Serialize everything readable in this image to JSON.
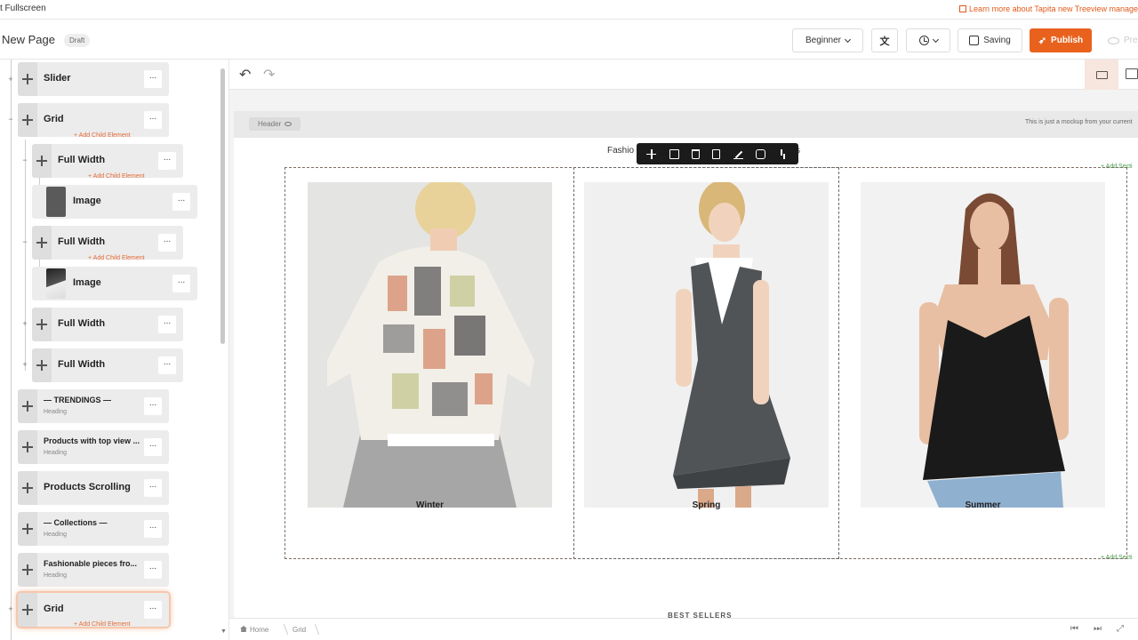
{
  "top_strip": {
    "exit_label": "t Fullscreen",
    "learn_more": "Learn more about Tapita new Treeview manage"
  },
  "header": {
    "page_title": "New Page",
    "status_badge": "Draft",
    "level_select": "Beginner",
    "saving_label": "Saving",
    "publish_label": "Publish",
    "preview_label": "Pre"
  },
  "sidebar": {
    "nodes": [
      {
        "label": "Slider"
      },
      {
        "label": "Grid",
        "add_child": "+ Add Child Element"
      },
      {
        "label": "Full Width",
        "add_child": "+ Add Child Element"
      },
      {
        "label": "Image"
      },
      {
        "label": "Full Width",
        "add_child": "+ Add Child Element"
      },
      {
        "label": "Image"
      },
      {
        "label": "Full Width"
      },
      {
        "label": "Full Width"
      },
      {
        "label": "— TRENDINGS —",
        "sub": "Heading"
      },
      {
        "label": "Products with top view ...",
        "sub": "Heading"
      },
      {
        "label": "Products Scrolling"
      },
      {
        "label": "— Collections —",
        "sub": "Heading"
      },
      {
        "label": "Fashionable pieces fro...",
        "sub": "Heading"
      },
      {
        "label": "Grid",
        "add_child": "+ Add Child Element"
      }
    ],
    "more_glyph": "..."
  },
  "canvas": {
    "header_chip": "Header",
    "mockup_note": "This is just a mockup from your current",
    "fashion_title_start": "Fashio",
    "fashion_title_end": "s",
    "add_section": "+ Add Secti",
    "best_sellers": "BEST SELLERS",
    "products": [
      {
        "label": "Winter"
      },
      {
        "label": "Spring"
      },
      {
        "label": "Summer"
      }
    ]
  },
  "footer": {
    "breadcrumb": [
      "Home",
      "Grid"
    ]
  },
  "colors": {
    "accent": "#e8621e",
    "add_child": "#e36b38",
    "add_section": "#4a9a4a"
  },
  "icons": [
    "move-icon",
    "duplicate-icon",
    "trash-icon",
    "copy-icon",
    "edit-icon",
    "database-icon",
    "select-parent-icon",
    "undo-icon",
    "redo-icon",
    "translate-icon",
    "clock-icon",
    "save-icon",
    "rocket-icon",
    "eye-icon",
    "desktop-icon",
    "tablet-icon",
    "home-icon"
  ]
}
